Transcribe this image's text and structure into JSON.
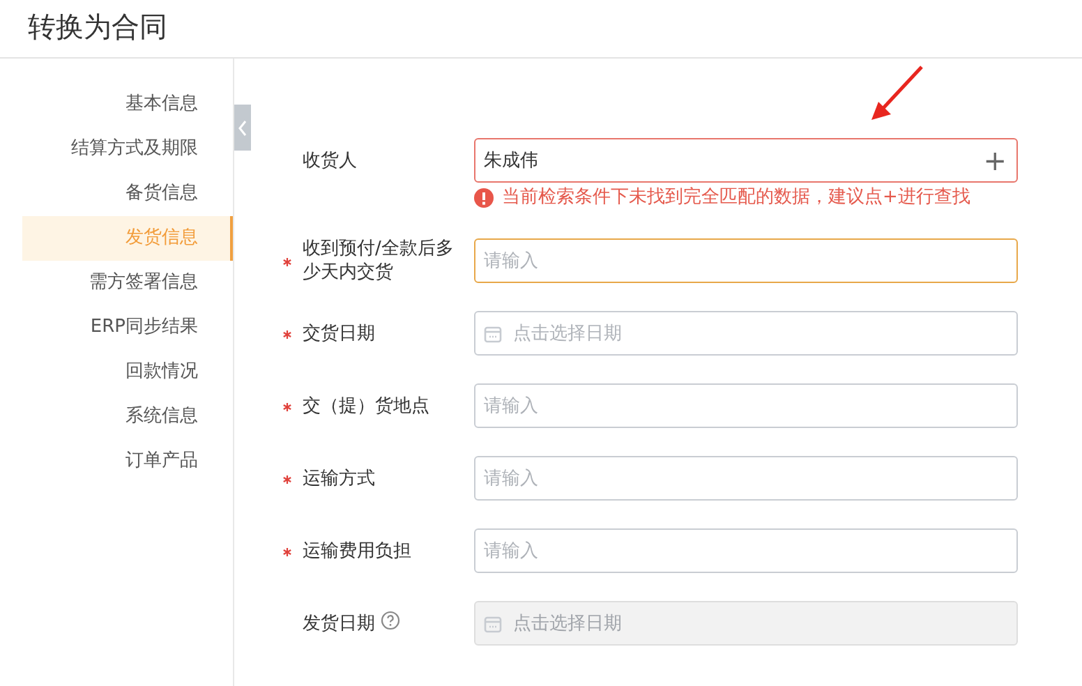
{
  "page": {
    "title": "转换为合同"
  },
  "sidebar": {
    "items": [
      {
        "label": "基本信息",
        "selected": false
      },
      {
        "label": "结算方式及期限",
        "selected": false
      },
      {
        "label": "备货信息",
        "selected": false
      },
      {
        "label": "发货信息",
        "selected": true
      },
      {
        "label": "需方签署信息",
        "selected": false
      },
      {
        "label": "ERP同步结果",
        "selected": false
      },
      {
        "label": "回款情况",
        "selected": false
      },
      {
        "label": "系统信息",
        "selected": false
      },
      {
        "label": "订单产品",
        "selected": false
      }
    ]
  },
  "form": {
    "fields": [
      {
        "kind": "lookup",
        "label": "收货人",
        "required": false,
        "help": false,
        "value": "朱成伟",
        "focused": false,
        "disabled": false,
        "action": "+",
        "error": "当前检索条件下未找到完全匹配的数据，建议点+进行查找"
      },
      {
        "kind": "text",
        "label": "收到预付/全款后多少天内交货",
        "required": true,
        "help": false,
        "placeholder": "请输入",
        "focused": true,
        "disabled": false
      },
      {
        "kind": "date",
        "label": "交货日期",
        "required": true,
        "help": false,
        "placeholder": "点击选择日期",
        "focused": false,
        "disabled": false
      },
      {
        "kind": "text",
        "label": "交（提）货地点",
        "required": true,
        "help": false,
        "placeholder": "请输入",
        "focused": false,
        "disabled": false
      },
      {
        "kind": "text",
        "label": "运输方式",
        "required": true,
        "help": false,
        "placeholder": "请输入",
        "focused": false,
        "disabled": false
      },
      {
        "kind": "text",
        "label": "运输费用负担",
        "required": true,
        "help": false,
        "placeholder": "请输入",
        "focused": false,
        "disabled": false
      },
      {
        "kind": "date",
        "label": "发货日期",
        "required": false,
        "help": true,
        "placeholder": "点击选择日期",
        "focused": false,
        "disabled": true
      }
    ]
  }
}
